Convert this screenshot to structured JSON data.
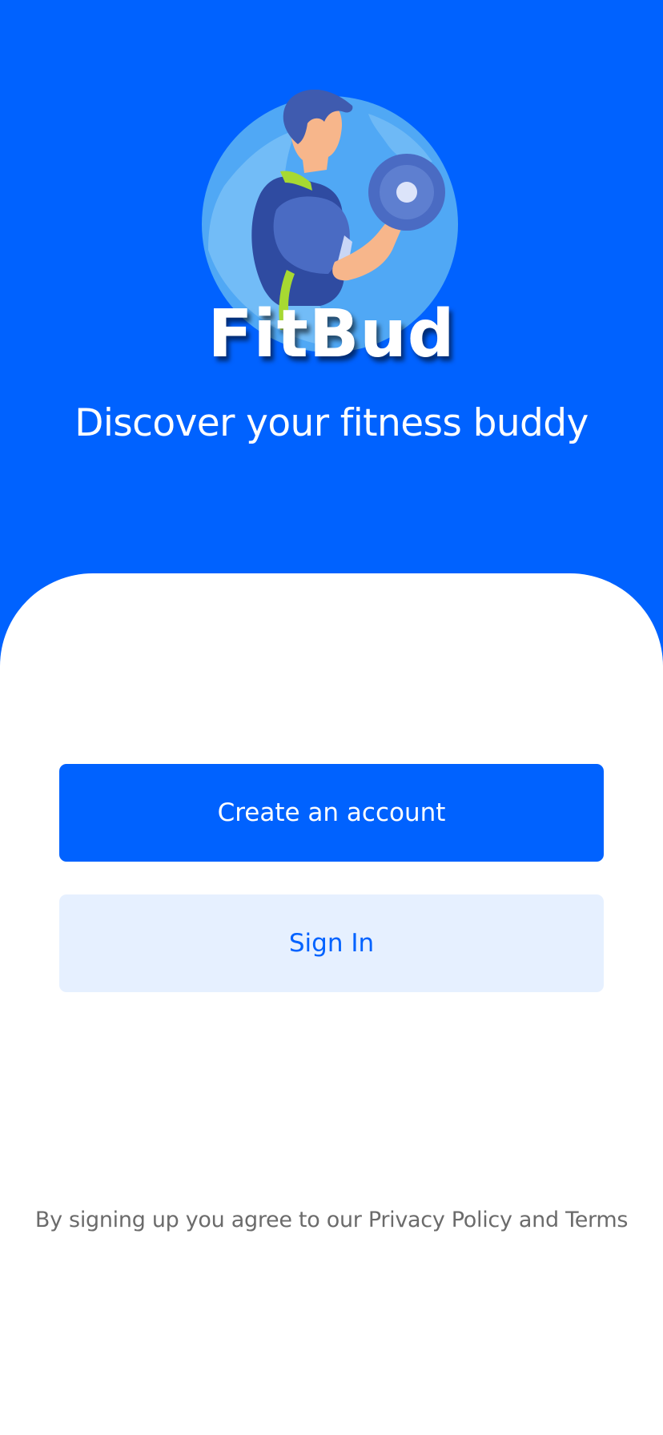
{
  "app": {
    "name": "FitBud",
    "tagline": "Discover your fitness buddy",
    "logo_icon": "man-lifting-dumbbell-icon"
  },
  "actions": {
    "create_account_label": "Create an account",
    "sign_in_label": "Sign In"
  },
  "footer": {
    "legal_text": "By signing up you agree to our Privacy Policy and Terms"
  },
  "colors": {
    "brand_blue": "#0062FF",
    "secondary_button_bg": "#E6F0FF",
    "legal_text": "#6B6B6B",
    "background": "#FFFFFF"
  }
}
